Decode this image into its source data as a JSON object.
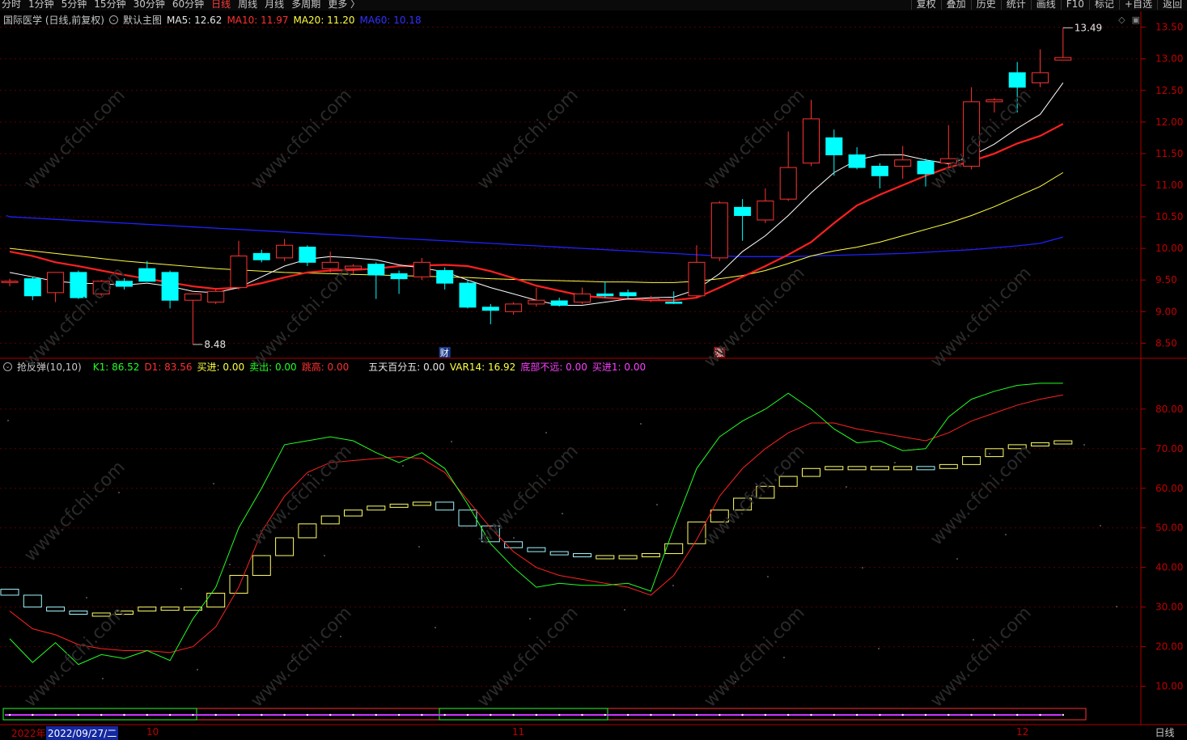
{
  "toolbar": {
    "periods": [
      "分时",
      "1分钟",
      "5分钟",
      "15分钟",
      "30分钟",
      "60分钟",
      "日线",
      "周线",
      "月线",
      "多周期",
      "更多 〉"
    ],
    "active_period": "日线",
    "right_buttons": [
      "复权",
      "叠加",
      "历史",
      "统计",
      "画线",
      "F10",
      "标记",
      "+自选",
      "返回"
    ]
  },
  "main_legend": {
    "title": "国际医学 (日线,前复权)",
    "template": "默认主图",
    "ma5_label": "MA5: 12.62",
    "ma10_label": "MA10: 11.97",
    "ma20_label": "MA20: 11.20",
    "ma60_label": "MA60: 10.18"
  },
  "sub_legend": {
    "title": "抢反弹(10,10)",
    "k1": "K1: 86.52",
    "d1": "D1: 83.56",
    "buy": "买进: 0.00",
    "sell": "卖出: 0.00",
    "jump": "跳高: 0.00",
    "five_day": "五天百分五: 0.00",
    "var14": "VAR14: 16.92",
    "bottom_near": "底部不远: 0.00",
    "buy1": "买进1: 0.00"
  },
  "markers": {
    "low_label": "8.48",
    "high_label": "13.49",
    "cai": "财",
    "zhang": "涨"
  },
  "bottom_axis": {
    "year": "2022年",
    "date": "2022/09/27/二",
    "m10": "10",
    "m11": "11",
    "m12": "12"
  },
  "period_label": "日线",
  "watermark": "www.cfchi.com",
  "colors": {
    "up": "#ff3232",
    "down": "#00ffff",
    "ma5": "#ffffff",
    "ma10": "#ff2020",
    "ma20": "#ffff40",
    "ma60": "#2020ff",
    "k1": "#22ff22",
    "d1": "#ff2222",
    "box": "#ffff66"
  },
  "chart_data": [
    {
      "type": "candlestick",
      "y_ticks": [
        8.5,
        9.0,
        9.5,
        10.0,
        10.5,
        11.0,
        11.5,
        12.0,
        12.5,
        13.0,
        13.5
      ],
      "ylim": [
        8.3,
        13.7
      ],
      "candles": [
        {
          "o": 9.48,
          "h": 9.52,
          "l": 9.4,
          "c": 9.48
        },
        {
          "o": 9.52,
          "h": 9.55,
          "l": 9.18,
          "c": 9.25
        },
        {
          "o": 9.3,
          "h": 9.62,
          "l": 9.15,
          "c": 9.62
        },
        {
          "o": 9.62,
          "h": 9.65,
          "l": 9.2,
          "c": 9.22
        },
        {
          "o": 9.28,
          "h": 9.5,
          "l": 9.25,
          "c": 9.48
        },
        {
          "o": 9.48,
          "h": 9.53,
          "l": 9.35,
          "c": 9.4
        },
        {
          "o": 9.68,
          "h": 9.8,
          "l": 9.48,
          "c": 9.48
        },
        {
          "o": 9.62,
          "h": 9.65,
          "l": 9.05,
          "c": 9.18
        },
        {
          "o": 9.18,
          "h": 9.28,
          "l": 8.48,
          "c": 9.28
        },
        {
          "o": 9.15,
          "h": 9.35,
          "l": 9.12,
          "c": 9.32
        },
        {
          "o": 9.38,
          "h": 10.12,
          "l": 9.35,
          "c": 9.88
        },
        {
          "o": 9.92,
          "h": 9.98,
          "l": 9.78,
          "c": 9.82
        },
        {
          "o": 9.85,
          "h": 10.15,
          "l": 9.8,
          "c": 10.05
        },
        {
          "o": 10.02,
          "h": 10.05,
          "l": 9.72,
          "c": 9.78
        },
        {
          "o": 9.68,
          "h": 9.95,
          "l": 9.62,
          "c": 9.78
        },
        {
          "o": 9.68,
          "h": 9.75,
          "l": 9.6,
          "c": 9.72
        },
        {
          "o": 9.75,
          "h": 9.78,
          "l": 9.2,
          "c": 9.58
        },
        {
          "o": 9.6,
          "h": 9.65,
          "l": 9.28,
          "c": 9.52
        },
        {
          "o": 9.55,
          "h": 9.85,
          "l": 9.5,
          "c": 9.78
        },
        {
          "o": 9.65,
          "h": 9.7,
          "l": 9.35,
          "c": 9.45
        },
        {
          "o": 9.45,
          "h": 9.5,
          "l": 9.05,
          "c": 9.07
        },
        {
          "o": 9.07,
          "h": 9.12,
          "l": 8.8,
          "c": 9.02
        },
        {
          "o": 9.0,
          "h": 9.15,
          "l": 8.95,
          "c": 9.12
        },
        {
          "o": 9.12,
          "h": 9.38,
          "l": 9.08,
          "c": 9.18
        },
        {
          "o": 9.17,
          "h": 9.22,
          "l": 9.08,
          "c": 9.1
        },
        {
          "o": 9.15,
          "h": 9.38,
          "l": 9.12,
          "c": 9.28
        },
        {
          "o": 9.28,
          "h": 9.48,
          "l": 9.22,
          "c": 9.25
        },
        {
          "o": 9.3,
          "h": 9.35,
          "l": 9.2,
          "c": 9.25
        },
        {
          "o": 9.18,
          "h": 9.25,
          "l": 9.15,
          "c": 9.2
        },
        {
          "o": 9.15,
          "h": 9.32,
          "l": 9.12,
          "c": 9.14
        },
        {
          "o": 9.25,
          "h": 10.05,
          "l": 9.22,
          "c": 9.78
        },
        {
          "o": 9.85,
          "h": 10.75,
          "l": 9.8,
          "c": 10.72
        },
        {
          "o": 10.65,
          "h": 10.78,
          "l": 10.12,
          "c": 10.52
        },
        {
          "o": 10.45,
          "h": 10.95,
          "l": 10.4,
          "c": 10.75
        },
        {
          "o": 10.78,
          "h": 11.85,
          "l": 10.75,
          "c": 11.28
        },
        {
          "o": 11.35,
          "h": 12.35,
          "l": 11.3,
          "c": 12.05
        },
        {
          "o": 11.75,
          "h": 11.88,
          "l": 11.15,
          "c": 11.48
        },
        {
          "o": 11.48,
          "h": 11.6,
          "l": 11.25,
          "c": 11.28
        },
        {
          "o": 11.3,
          "h": 11.35,
          "l": 10.95,
          "c": 11.15
        },
        {
          "o": 11.3,
          "h": 11.62,
          "l": 11.1,
          "c": 11.4
        },
        {
          "o": 11.38,
          "h": 11.42,
          "l": 10.98,
          "c": 11.18
        },
        {
          "o": 11.35,
          "h": 11.95,
          "l": 11.3,
          "c": 11.42
        },
        {
          "o": 11.3,
          "h": 12.55,
          "l": 11.25,
          "c": 12.32
        },
        {
          "o": 12.32,
          "h": 12.38,
          "l": 12.15,
          "c": 12.35
        },
        {
          "o": 12.78,
          "h": 12.95,
          "l": 12.15,
          "c": 12.55
        },
        {
          "o": 12.62,
          "h": 13.15,
          "l": 12.55,
          "c": 12.78
        },
        {
          "o": 12.98,
          "h": 13.49,
          "l": 12.98,
          "c": 13.02
        }
      ],
      "ma5": [
        9.62,
        9.55,
        9.48,
        9.45,
        9.44,
        9.42,
        9.45,
        9.4,
        9.32,
        9.3,
        9.38,
        9.55,
        9.72,
        9.83,
        9.87,
        9.85,
        9.82,
        9.74,
        9.69,
        9.63,
        9.5,
        9.38,
        9.28,
        9.18,
        9.1,
        9.1,
        9.15,
        9.2,
        9.22,
        9.23,
        9.35,
        9.6,
        9.95,
        10.2,
        10.52,
        10.88,
        11.2,
        11.4,
        11.48,
        11.48,
        11.4,
        11.34,
        11.46,
        11.65,
        11.9,
        12.12,
        12.62
      ],
      "ma10": [
        9.95,
        9.88,
        9.78,
        9.72,
        9.65,
        9.58,
        9.52,
        9.46,
        9.4,
        9.36,
        9.38,
        9.45,
        9.54,
        9.62,
        9.65,
        9.66,
        9.68,
        9.72,
        9.73,
        9.74,
        9.72,
        9.64,
        9.53,
        9.41,
        9.33,
        9.25,
        9.22,
        9.2,
        9.18,
        9.18,
        9.22,
        9.38,
        9.55,
        9.72,
        9.9,
        10.1,
        10.4,
        10.68,
        10.85,
        11.0,
        11.15,
        11.28,
        11.38,
        11.5,
        11.66,
        11.78,
        11.97
      ],
      "ma20": [
        10.0,
        9.96,
        9.92,
        9.88,
        9.84,
        9.8,
        9.77,
        9.74,
        9.71,
        9.68,
        9.66,
        9.64,
        9.62,
        9.61,
        9.6,
        9.59,
        9.58,
        9.57,
        9.56,
        9.55,
        9.54,
        9.52,
        9.51,
        9.5,
        9.49,
        9.48,
        9.47,
        9.47,
        9.46,
        9.46,
        9.48,
        9.52,
        9.57,
        9.65,
        9.76,
        9.88,
        9.96,
        10.02,
        10.1,
        10.2,
        10.3,
        10.4,
        10.52,
        10.66,
        10.82,
        10.98,
        11.2
      ],
      "ma60": [
        10.5,
        10.48,
        10.46,
        10.44,
        10.42,
        10.4,
        10.38,
        10.36,
        10.34,
        10.32,
        10.3,
        10.28,
        10.26,
        10.24,
        10.22,
        10.2,
        10.18,
        10.16,
        10.14,
        10.12,
        10.1,
        10.08,
        10.06,
        10.04,
        10.02,
        10.0,
        9.98,
        9.96,
        9.94,
        9.92,
        9.9,
        9.88,
        9.87,
        9.87,
        9.87,
        9.88,
        9.89,
        9.9,
        9.91,
        9.92,
        9.94,
        9.96,
        9.98,
        10.01,
        10.04,
        10.08,
        10.18
      ]
    },
    {
      "type": "line",
      "title": "抢反弹(10,10)",
      "y_ticks": [
        10,
        20,
        30,
        40,
        50,
        60,
        70,
        80
      ],
      "ylim": [
        5,
        91
      ],
      "k1": [
        22,
        16,
        21,
        15.5,
        18,
        17,
        19,
        16.5,
        27,
        35,
        50,
        60,
        71,
        72,
        73,
        72,
        69,
        66.5,
        69,
        65,
        56,
        46,
        40,
        35,
        36,
        35.5,
        35.5,
        36,
        34,
        50,
        65,
        73,
        77,
        80,
        84,
        80,
        75,
        71.5,
        72,
        69.5,
        70,
        78,
        82.5,
        84.5,
        86,
        86.52,
        86.52
      ],
      "d1": [
        29,
        24.5,
        23,
        20.5,
        19.5,
        19,
        19,
        18.5,
        20,
        25,
        35,
        49,
        58,
        64,
        66.5,
        67,
        67.5,
        68,
        67.5,
        64,
        57,
        50,
        44,
        40,
        38,
        37,
        36,
        35,
        33,
        38,
        47,
        58,
        65,
        70,
        74,
        76.5,
        76.5,
        75,
        74,
        73,
        72,
        74,
        77,
        79,
        81,
        82.5,
        83.56
      ],
      "box_mid": [
        33,
        30,
        29,
        28.5,
        28.5,
        29,
        30,
        30,
        30,
        33.5,
        38,
        43,
        47.5,
        51,
        53,
        54.5,
        55.5,
        56,
        56.5,
        54.5,
        50.5,
        46.5,
        45,
        44,
        43.5,
        43,
        43,
        43,
        43.5,
        46,
        51.5,
        54.5,
        57.5,
        60.5,
        63,
        65,
        65.5,
        65.5,
        65.5,
        65.5,
        65,
        66,
        68,
        70,
        71,
        71.5,
        72
      ]
    }
  ]
}
